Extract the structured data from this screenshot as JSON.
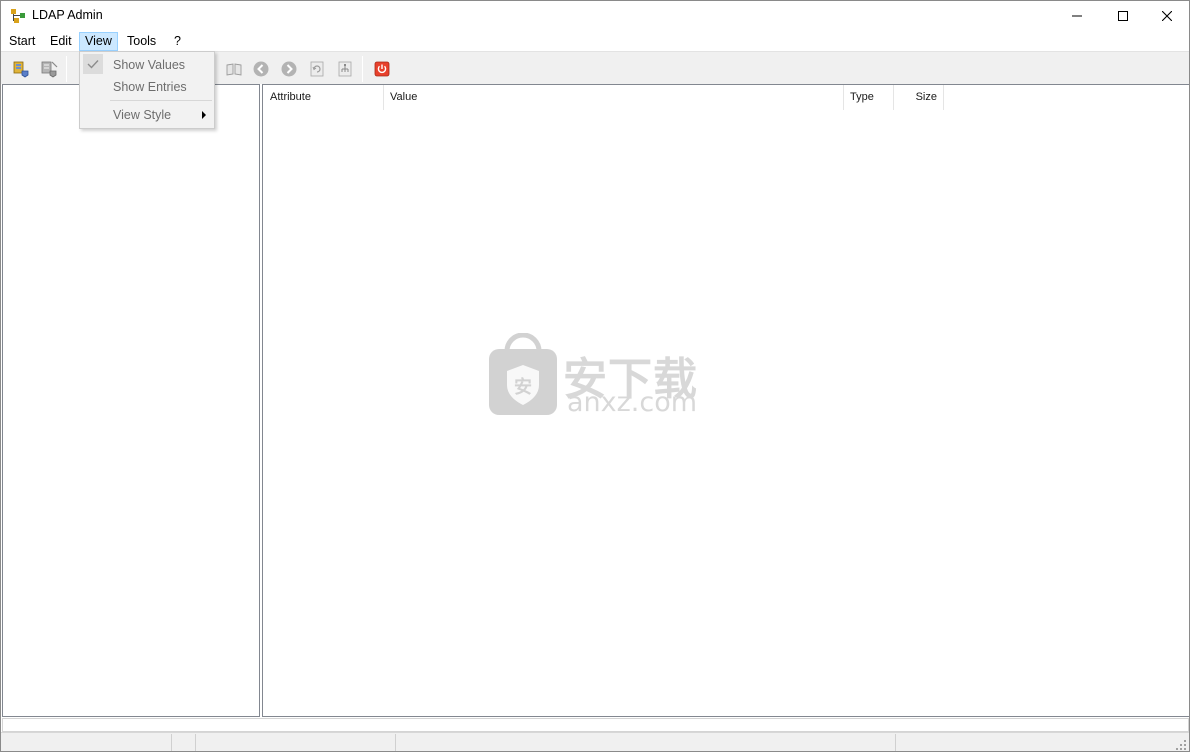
{
  "window": {
    "title": "LDAP Admin",
    "icon": "ldap-tree-icon"
  },
  "menubar": {
    "items": [
      {
        "label": "Start"
      },
      {
        "label": "Edit"
      },
      {
        "label": "View",
        "active": true
      },
      {
        "label": "Tools"
      },
      {
        "label": "?"
      }
    ]
  },
  "toolbar": {
    "buttons": [
      {
        "icon": "connect-icon",
        "enabled": true
      },
      {
        "icon": "disconnect-icon",
        "enabled": false
      },
      {
        "icon": "book-icon",
        "enabled": false
      },
      {
        "icon": "back-arrow-icon",
        "enabled": false
      },
      {
        "icon": "forward-arrow-icon",
        "enabled": false
      },
      {
        "icon": "refresh-icon",
        "enabled": false
      },
      {
        "icon": "schema-icon",
        "enabled": false
      },
      {
        "icon": "exit-icon",
        "enabled": true,
        "color": "#e8412c"
      }
    ]
  },
  "view_menu": {
    "items": [
      {
        "label": "Show Values",
        "checked": true,
        "enabled": false
      },
      {
        "label": "Show Entries",
        "checked": false,
        "enabled": false
      },
      {
        "label": "View Style",
        "submenu": true,
        "enabled": false
      }
    ]
  },
  "attributes_table": {
    "columns": [
      "Attribute",
      "Value",
      "Type",
      "Size"
    ],
    "rows": []
  },
  "watermark": {
    "text_cn": "安下载",
    "text_en": "anxz.com",
    "shield_char": "安"
  },
  "colors": {
    "menu_highlight": "#cce8ff",
    "toolbar_bg": "#f0f0f0",
    "exit_red": "#e8412c"
  }
}
